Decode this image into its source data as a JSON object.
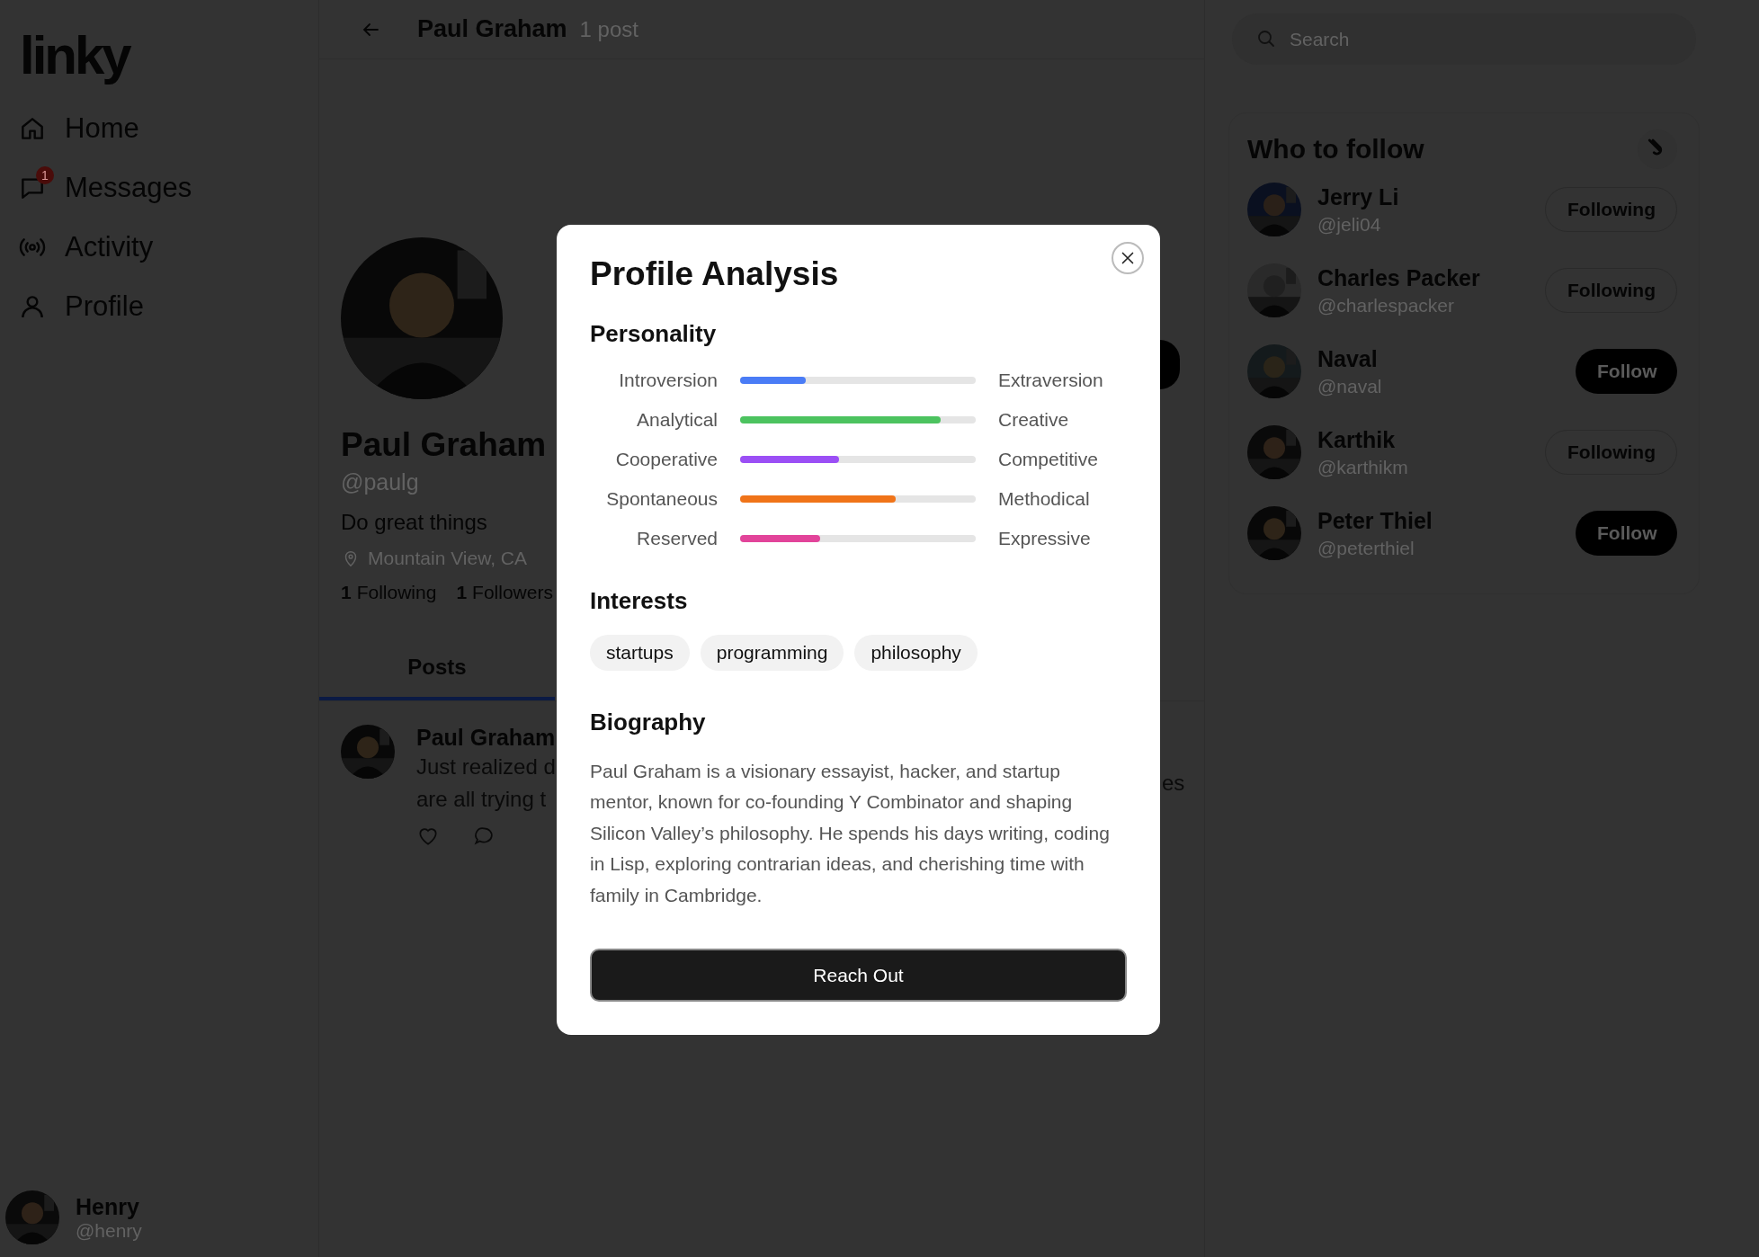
{
  "sidebar": {
    "logo": "linky",
    "nav": [
      {
        "label": "Home"
      },
      {
        "label": "Messages",
        "badge": "1"
      },
      {
        "label": "Activity"
      },
      {
        "label": "Profile"
      }
    ],
    "user": {
      "name": "Henry",
      "handle": "@henry"
    }
  },
  "header": {
    "title": "Paul Graham",
    "subtitle": "1 post"
  },
  "profile": {
    "name": "Paul Graham",
    "handle": "@paulg",
    "bio": "Do great things",
    "location": "Mountain View, CA",
    "stats": [
      {
        "count": "1",
        "label": "Following"
      },
      {
        "count": "1",
        "label": "Followers"
      }
    ]
  },
  "tabs": [
    {
      "label": "Posts",
      "selected": true
    }
  ],
  "post": {
    "author": "Paul Graham",
    "lines": [
      "Just realized d",
      "are all trying t"
    ],
    "line_end": "es"
  },
  "search": {
    "placeholder": "Search"
  },
  "who_to_follow": {
    "title": "Who to follow",
    "users": [
      {
        "name": "Jerry Li",
        "handle": "@jeli04",
        "button": "Following",
        "following": true
      },
      {
        "name": "Charles Packer",
        "handle": "@charlespacker",
        "button": "Following",
        "following": true
      },
      {
        "name": "Naval",
        "handle": "@naval",
        "button": "Follow",
        "following": false
      },
      {
        "name": "Karthik",
        "handle": "@karthikm",
        "button": "Following",
        "following": true
      },
      {
        "name": "Peter Thiel",
        "handle": "@peterthiel",
        "button": "Follow",
        "following": false
      }
    ]
  },
  "modal": {
    "title": "Profile Analysis",
    "personality_title": "Personality",
    "traits": [
      {
        "left": "Introversion",
        "right": "Extraversion",
        "level": 0.28,
        "color": "#4a7cf6"
      },
      {
        "left": "Analytical",
        "right": "Creative",
        "level": 0.85,
        "color": "#4cc35f"
      },
      {
        "left": "Cooperative",
        "right": "Competitive",
        "level": 0.42,
        "color": "#9b4ff5"
      },
      {
        "left": "Spontaneous",
        "right": "Methodical",
        "level": 0.66,
        "color": "#f07419"
      },
      {
        "left": "Reserved",
        "right": "Expressive",
        "level": 0.34,
        "color": "#e2449a"
      }
    ],
    "interests_title": "Interests",
    "interests": [
      "startups",
      "programming",
      "philosophy"
    ],
    "biography_title": "Biography",
    "biography": "Paul Graham is a visionary essayist, hacker, and startup mentor, known for co-founding Y Combinator and shaping Silicon Valley’s philosophy. He spends his days writing, coding in Lisp, exploring contrarian ideas, and cherishing time with family in Cambridge.",
    "button": "Reach Out"
  }
}
